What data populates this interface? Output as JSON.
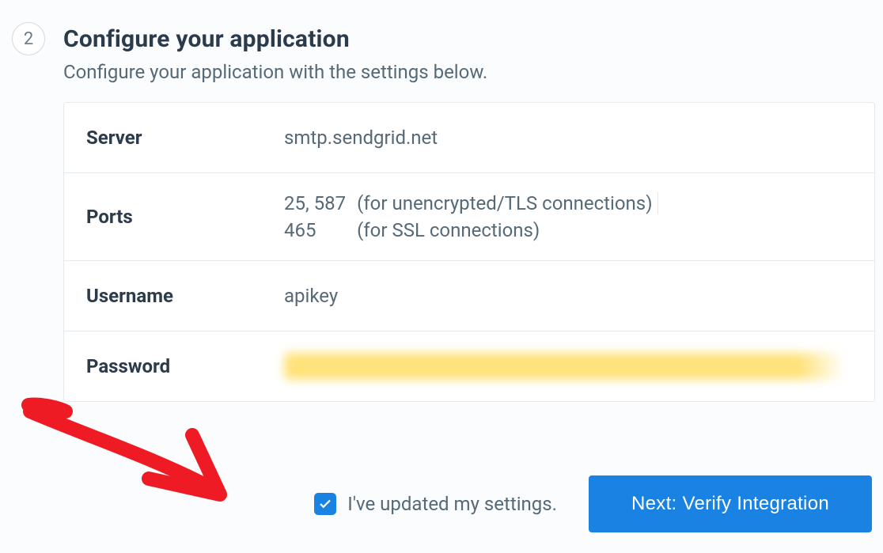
{
  "step": {
    "number": "2",
    "title": "Configure your application",
    "subtitle": "Configure your application with the settings below."
  },
  "settings": {
    "server_label": "Server",
    "server_value": "smtp.sendgrid.net",
    "ports_label": "Ports",
    "ports_tls_value": "25, 587",
    "ports_tls_desc": "(for unencrypted/TLS connections)",
    "ports_ssl_value": "465",
    "ports_ssl_desc": "(for SSL connections)",
    "username_label": "Username",
    "username_value": "apikey",
    "password_label": "Password"
  },
  "footer": {
    "checkbox_label": "I've updated my settings.",
    "checkbox_checked": true,
    "next_button": "Next: Verify Integration"
  }
}
